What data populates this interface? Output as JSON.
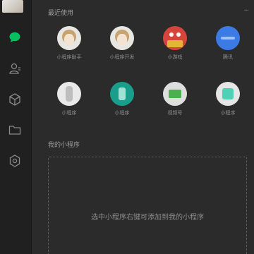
{
  "sidebar": {
    "items": [
      {
        "name": "chat-icon",
        "active": true
      },
      {
        "name": "contacts-icon",
        "active": false
      },
      {
        "name": "cube-icon",
        "active": false
      },
      {
        "name": "folder-icon",
        "active": false
      },
      {
        "name": "mini-program-icon",
        "active": false
      }
    ],
    "accent_color": "#07c160"
  },
  "main": {
    "recent_title": "最近使用",
    "more_label": "···",
    "recent_apps": [
      {
        "label": "小程序助手",
        "icon": "avatar-icon"
      },
      {
        "label": "小程序开发",
        "icon": "avatar-icon"
      },
      {
        "label": "小游戏",
        "icon": "game-icon"
      },
      {
        "label": "腾讯",
        "icon": "blue-app-icon"
      },
      {
        "label": "小程序",
        "icon": "white-app-icon"
      },
      {
        "label": "小程序",
        "icon": "teal-app-icon"
      },
      {
        "label": "视频号",
        "icon": "green-app-icon"
      },
      {
        "label": "小程序",
        "icon": "mint-app-icon"
      }
    ],
    "my_title": "我的小程序",
    "drop_hint": "选中小程序右键可添加到我的小程序"
  }
}
